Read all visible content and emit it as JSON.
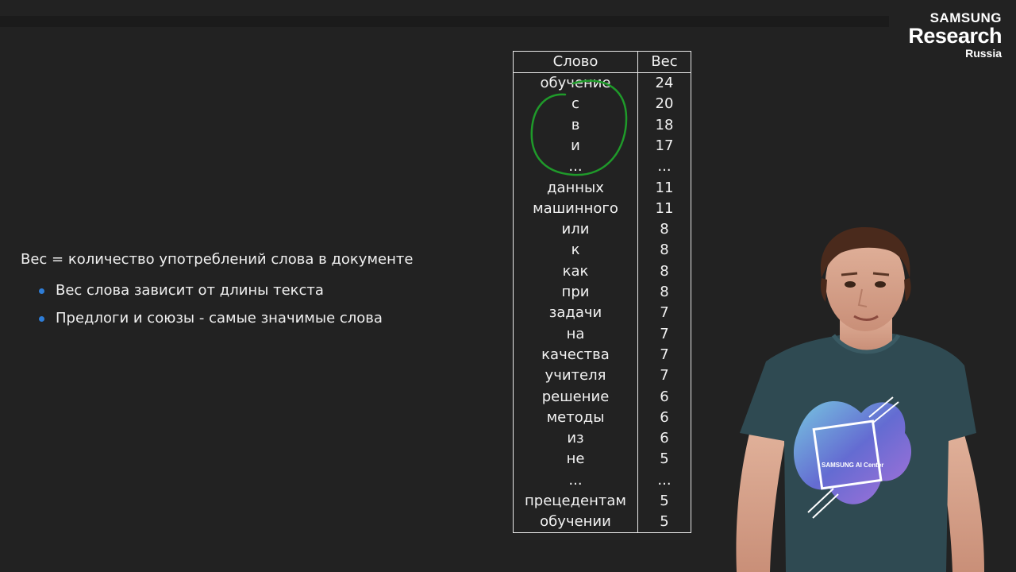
{
  "logo": {
    "line1": "SAMSUNG",
    "line2": "Research",
    "line3": "Russia"
  },
  "slide": {
    "definition": "Вес = количество употреблений слова в документе",
    "bullets": [
      "Вес слова зависит от длины текста",
      "Предлоги и союзы - самые значимые слова"
    ]
  },
  "table": {
    "headers": {
      "word": "Слово",
      "weight": "Вес"
    },
    "rows": [
      {
        "word": "обучение",
        "weight": "24"
      },
      {
        "word": "с",
        "weight": "20"
      },
      {
        "word": "в",
        "weight": "18"
      },
      {
        "word": "и",
        "weight": "17"
      },
      {
        "word": "...",
        "weight": "..."
      },
      {
        "word": "данных",
        "weight": "11"
      },
      {
        "word": "машинного",
        "weight": "11"
      },
      {
        "word": "или",
        "weight": "8"
      },
      {
        "word": "к",
        "weight": "8"
      },
      {
        "word": "как",
        "weight": "8"
      },
      {
        "word": "при",
        "weight": "8"
      },
      {
        "word": "задачи",
        "weight": "7"
      },
      {
        "word": "на",
        "weight": "7"
      },
      {
        "word": "качества",
        "weight": "7"
      },
      {
        "word": "учителя",
        "weight": "7"
      },
      {
        "word": "решение",
        "weight": "6"
      },
      {
        "word": "методы",
        "weight": "6"
      },
      {
        "word": "из",
        "weight": "6"
      },
      {
        "word": "не",
        "weight": "5"
      },
      {
        "word": "...",
        "weight": "..."
      },
      {
        "word": "прецедентам",
        "weight": "5"
      },
      {
        "word": "обучении",
        "weight": "5"
      }
    ]
  },
  "annotation": {
    "color": "#1f9a2a"
  },
  "presenter": {
    "shirt_text": "SAMSUNG AI Center"
  },
  "colors": {
    "background": "#222222",
    "bullet": "#2e7dd7",
    "text": "#f0f0f0"
  }
}
